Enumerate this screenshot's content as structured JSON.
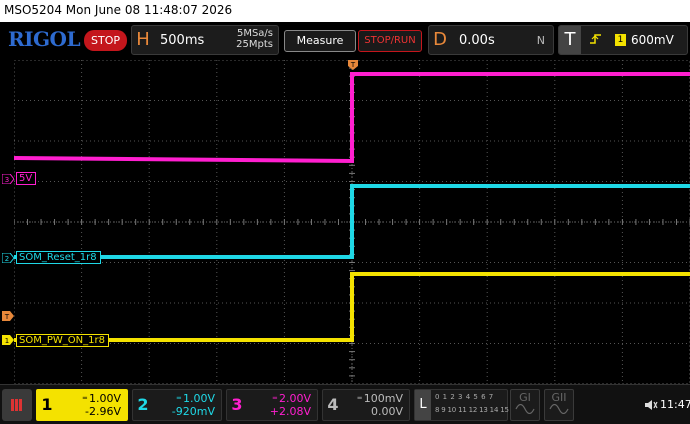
{
  "title_bar": {
    "model": "MSO5204",
    "datetime": "Mon June 08 11:48:07 2026"
  },
  "toolbar": {
    "logo": "RIGOL",
    "run_state": "STOP",
    "horizontal": {
      "letter": "H",
      "timebase": "500ms",
      "sample_rate": "5MSa/s",
      "memory_depth": "25Mpts"
    },
    "measure_label": "Measure",
    "stop_run_label": "STOP/RUN",
    "delay": {
      "letter": "D",
      "value": "0.00s",
      "mode": "N"
    },
    "trigger": {
      "letter": "T",
      "slope_icon": "rising-edge-icon",
      "source": "1",
      "level": "600mV"
    }
  },
  "waveform": {
    "trigger_marker": "T",
    "channels": [
      {
        "id": "3",
        "label": "5V",
        "color": "#ff1fcf"
      },
      {
        "id": "2",
        "label": "SOM_Reset_1r8",
        "color": "#1fd8e6"
      },
      {
        "id": "1",
        "label": "SOM_PW_ON_1r8",
        "color": "#f4e200"
      }
    ],
    "trigger_level_marker": "T"
  },
  "statusbar": {
    "channels": [
      {
        "num": "1",
        "coupling": "DC",
        "scale": "1.00V",
        "offset": "-2.96V",
        "color": "#f4e200"
      },
      {
        "num": "2",
        "coupling": "DC",
        "scale": "1.00V",
        "offset": "-920mV",
        "color": "#1fd8e6"
      },
      {
        "num": "3",
        "coupling": "DC",
        "scale": "2.00V",
        "offset": "+2.08V",
        "color": "#ff1fcf"
      },
      {
        "num": "4",
        "coupling": "DC",
        "scale": "100mV",
        "offset": "0.00V",
        "color": "#bbbbbb"
      }
    ],
    "logic_analyzer": {
      "letter": "L",
      "row1": "0 1 2 3   4 5 6 7",
      "row2": "8 9 10 11 12 13 14 15"
    },
    "generators": [
      {
        "label": "GI"
      },
      {
        "label": "GII"
      }
    ],
    "clock": "11:47"
  }
}
